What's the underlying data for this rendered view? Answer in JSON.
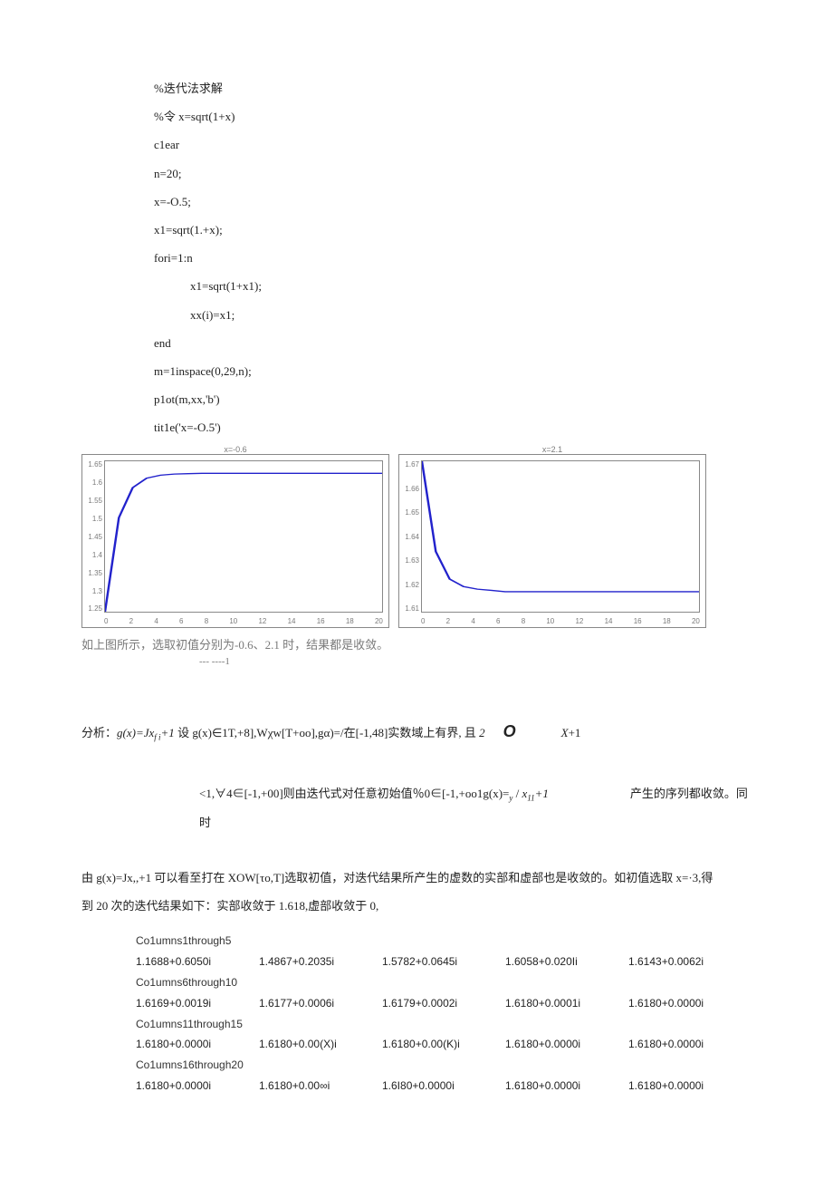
{
  "code": {
    "l1": "%迭代法求解",
    "l2": "%令 x=sqrt(1+x)",
    "l3": "c1ear",
    "l4": "n=20;",
    "l5": "x=-O.5;",
    "l6": "x1=sqrt(1.+x);",
    "l7": "fori=1:n",
    "l8": "x1=sqrt(1+x1);",
    "l9": "xx(i)=x1;",
    "l10": "end",
    "l11": "m=1inspace(0,29,n);",
    "l12": "p1ot(m,xx,'b')",
    "l13": "tit1e('x=-O.5')"
  },
  "chart_data": [
    {
      "type": "line",
      "title": "x=-0.6",
      "x": [
        0,
        1,
        2,
        3,
        4,
        5,
        6,
        7,
        8,
        9,
        10,
        11,
        12,
        13,
        14,
        15,
        16,
        17,
        18,
        19,
        20
      ],
      "y": [
        1.25,
        1.5,
        1.58,
        1.605,
        1.613,
        1.616,
        1.617,
        1.618,
        1.618,
        1.618,
        1.618,
        1.618,
        1.618,
        1.618,
        1.618,
        1.618,
        1.618,
        1.618,
        1.618,
        1.618,
        1.618
      ],
      "xlim": [
        0,
        20
      ],
      "ylim": [
        1.25,
        1.65
      ],
      "xticks": [
        0,
        2,
        4,
        6,
        8,
        10,
        12,
        14,
        16,
        18,
        20
      ],
      "yticks": [
        1.25,
        1.3,
        1.35,
        1.4,
        1.45,
        1.5,
        1.55,
        1.6,
        1.65
      ]
    },
    {
      "type": "line",
      "title": "x=2.1",
      "x": [
        0,
        1,
        2,
        3,
        4,
        5,
        6,
        7,
        8,
        9,
        10,
        11,
        12,
        13,
        14,
        15,
        16,
        17,
        18,
        19,
        20
      ],
      "y": [
        1.67,
        1.634,
        1.623,
        1.62,
        1.619,
        1.6185,
        1.618,
        1.618,
        1.618,
        1.618,
        1.618,
        1.618,
        1.618,
        1.618,
        1.618,
        1.618,
        1.618,
        1.618,
        1.618,
        1.618,
        1.618
      ],
      "xlim": [
        0,
        20
      ],
      "ylim": [
        1.61,
        1.67
      ],
      "xticks": [
        0,
        2,
        4,
        6,
        8,
        10,
        12,
        14,
        16,
        18,
        20
      ],
      "yticks": [
        1.61,
        1.62,
        1.63,
        1.64,
        1.65,
        1.66,
        1.67
      ]
    }
  ],
  "caption1": "如上图所示，选取初值分别为-0.6、2.1 时，结果都是收敛。",
  "subcap": "--- ----1",
  "analysis": {
    "aprefix": "分析：",
    "a1a": "g(x)=Jx",
    "a1a_sub": "f i",
    "a1b": "+1 ",
    "a1c": "设 g(x)∈1T,+8],Wχw[T+oo],gα)=/在[-1,48]实数域上有界, 且 ",
    "a1d": "2",
    "a1e": "O",
    "a1f": "X",
    "a1g": "+1",
    "a2a": "<1,∀4∈[-1,+00]则由迭代式对任意初始值％0∈[-1,+oo1g(x)=",
    "a2b_sub": "y",
    "a2c": " / ",
    "a2d": "x",
    "a2d_sub": "11",
    "a2e": "+1",
    "a2f": "产生的序列都收敛。同时",
    "a3": "由 g(x)=Jx,,+1 可以看至打在 XOW[τo,T]选取初值，对迭代结果所产生的虚数的实部和虚部也是收敛的。如初值选取 x=·3,得",
    "a4": "到 20 次的迭代结果如下：实部收敛于 1.618,虚部收敛于 0,"
  },
  "table": {
    "h1": "Co1umns1through5",
    "r1": [
      "1.1688+0.6050i",
      "1.4867+0.2035i",
      "1.5782+0.0645i",
      "1.6058+0.020Ii",
      "1.6143+0.0062i"
    ],
    "h2": "Co1umns6through10",
    "r2": [
      "1.6169+0.0019i",
      "1.6177+0.0006i",
      "1.6179+0.0002i",
      "1.6180+0.0001i",
      "1.6180+0.0000i"
    ],
    "h3": "Co1umns11through15",
    "r3": [
      "1.6180+0.0000i",
      "1.6180+0.00(X)i",
      "1.6180+0.00(K)i",
      "1.6180+0.0000i",
      "1.6180+0.0000i"
    ],
    "h4": "Co1umns16through20",
    "r4": [
      "1.6180+0.0000i",
      "1.6180+0.00∞i",
      "1.6I80+0.0000i",
      "1.6180+0.0000i",
      "1.6180+0.0000i"
    ]
  }
}
